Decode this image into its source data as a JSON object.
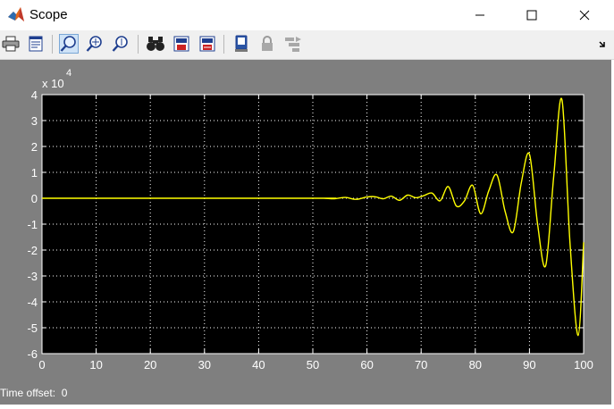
{
  "window": {
    "title": "Scope",
    "controls": [
      "minimize",
      "maximize",
      "close"
    ]
  },
  "toolbar": {
    "buttons": [
      {
        "name": "print",
        "icon": "printer-icon"
      },
      {
        "name": "parameters",
        "icon": "parameters-icon"
      },
      {
        "name": "zoom",
        "icon": "zoom-icon",
        "active": true
      },
      {
        "name": "zoom-x",
        "icon": "zoom-x-icon"
      },
      {
        "name": "zoom-y",
        "icon": "zoom-y-icon"
      },
      {
        "name": "autoscale",
        "icon": "binoculars-icon"
      },
      {
        "name": "save-axes",
        "icon": "save-axes-icon"
      },
      {
        "name": "restore-axes",
        "icon": "restore-axes-icon"
      },
      {
        "name": "floating-scope",
        "icon": "floating-scope-icon"
      },
      {
        "name": "lock-axes",
        "icon": "lock-icon"
      },
      {
        "name": "signal-selection",
        "icon": "signal-selection-icon"
      }
    ],
    "overflow_icon": "chevron-icon"
  },
  "status": {
    "time_offset_label": "Time offset:",
    "time_offset_value": "0"
  },
  "colors": {
    "figure_bg": "#7f7f7f",
    "axes_bg": "#000000",
    "trace": "#ffff00",
    "grid": "#ffffff",
    "text": "#ffffff"
  },
  "chart_data": {
    "type": "line",
    "title": "",
    "xlabel": "",
    "ylabel": "",
    "exponent_label": "x 10",
    "exponent_power": "4",
    "xlim": [
      0,
      100
    ],
    "ylim": [
      -6,
      4
    ],
    "xticks": [
      0,
      10,
      20,
      30,
      40,
      50,
      60,
      70,
      80,
      90,
      100
    ],
    "yticks": [
      4,
      3,
      2,
      1,
      0,
      -1,
      -2,
      -3,
      -4,
      -5,
      -6
    ],
    "grid": true,
    "grid_style": "dotted",
    "series": [
      {
        "color": "#ffff00",
        "x": [
          0,
          50,
          52,
          54,
          56,
          58,
          60,
          61.5,
          63,
          64.5,
          66,
          67.5,
          69,
          70.5,
          72,
          73.5,
          75,
          76.5,
          78,
          79.5,
          81,
          82.5,
          84,
          85.5,
          87,
          88.5,
          90,
          91.5,
          93,
          94.5,
          96,
          97.5,
          99,
          100
        ],
        "y": [
          0,
          0,
          0,
          -0.02,
          0.03,
          -0.04,
          0.05,
          0.06,
          -0.02,
          0.08,
          -0.08,
          0.12,
          0.02,
          0.1,
          0.2,
          -0.1,
          0.45,
          -0.3,
          -0.1,
          0.5,
          -0.6,
          0.3,
          0.9,
          -0.5,
          -1.3,
          0.6,
          1.7,
          -1.0,
          -2.6,
          0.9,
          3.8,
          -1.8,
          -5.3,
          -1.7
        ]
      }
    ]
  }
}
